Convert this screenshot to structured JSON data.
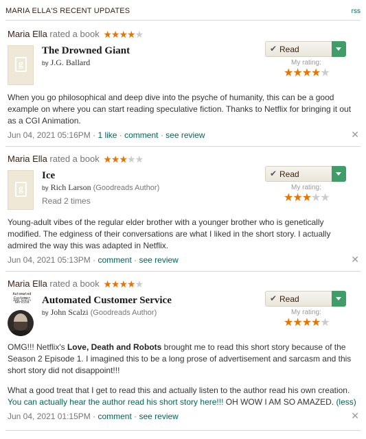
{
  "header": {
    "title": "MARIA ELLA'S RECENT UPDATES",
    "rss": "rss"
  },
  "updates": [
    {
      "actor": "Maria Ella",
      "verb": "rated a book",
      "stars": 4,
      "book_title": "The Drowned Giant",
      "by": "by",
      "author": "J.G. Ballard",
      "author_tag": "",
      "read_times": "",
      "shelf": "Read",
      "my_rating_label": "My rating:",
      "my_rating": 4,
      "review_paragraphs": [
        "When you go philosophical and deep dive into the psyche of humanity, this can be a good example on where you can start reading speculative fiction. Thanks to Netflix for bringing it out as a CGI Animation."
      ],
      "timestamp": "Jun 04, 2021 05:16PM",
      "likes": "1 like",
      "comment": "comment",
      "see_review": "see review"
    },
    {
      "actor": "Maria Ella",
      "verb": "rated a book",
      "stars": 3,
      "book_title": "Ice",
      "by": "by",
      "author": "Rich Larson",
      "author_tag": "(Goodreads Author)",
      "read_times": "Read 2 times",
      "shelf": "Read",
      "my_rating_label": "My rating:",
      "my_rating": 3,
      "review_paragraphs": [
        "Young-adult vibes of the regular elder brother with a younger brother who is genetically modified. The edginess of their conversations are what I liked in the short story. I actually admired the way this was adapted in Netflix."
      ],
      "timestamp": "Jun 04, 2021 05:13PM",
      "likes": "",
      "comment": "comment",
      "see_review": "see review"
    },
    {
      "actor": "Maria Ella",
      "verb": "rated a book",
      "stars": 4,
      "book_title": "Automated Customer Service",
      "cover_title": "Automated Customer Service",
      "cover_author": "John Scalzi",
      "by": "by",
      "author": "John Scalzi",
      "author_tag": "(Goodreads Author)",
      "read_times": "",
      "shelf": "Read",
      "my_rating_label": "My rating:",
      "my_rating": 4,
      "review_p1_a": "OMG!!! Netflix's ",
      "review_p1_bold": "Love, Death and Robots",
      "review_p1_b": " brought me to read this short story because of the Season 2 Episode 1. I imagined this to be a long prose of advertisement and sarcasm and this short story did not disappoint!!!",
      "review_p2_a": "What a good treat that I get to read this and actually listen to the author read his own creation. ",
      "review_p2_link": "You can actually hear the author read his short story here!!!",
      "review_p2_b": " OH WOW I AM SO AMAZED. ",
      "review_p2_less": "(less)",
      "timestamp": "Jun 04, 2021 01:15PM",
      "likes": "",
      "comment": "comment",
      "see_review": "see review"
    }
  ],
  "colors": {
    "accent": "#00635d",
    "star": "#e87400",
    "shelf_green": "#409d69",
    "header_text": "#382110"
  },
  "icons": {
    "close": "close-icon",
    "check": "check-icon",
    "dropdown": "chevron-down-icon",
    "cover_placeholder": "book-placeholder-icon"
  }
}
